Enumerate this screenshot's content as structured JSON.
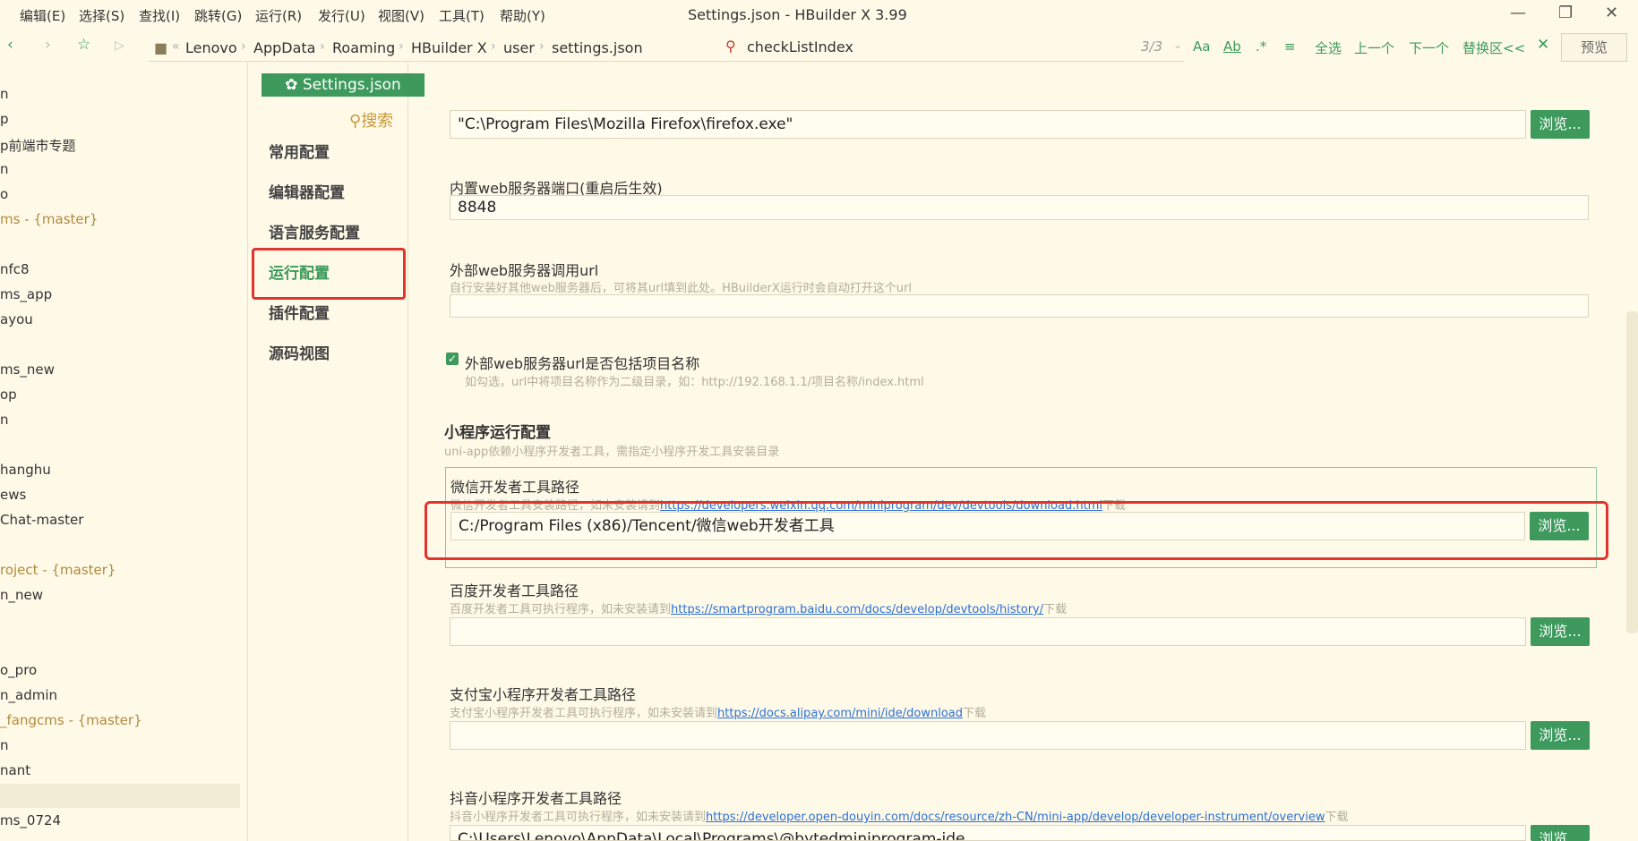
{
  "menu": [
    "编辑(E)",
    "选择(S)",
    "查找(I)",
    "跳转(G)",
    "运行(R)",
    "发行(U)",
    "视图(V)",
    "工具(T)",
    "帮助(Y)"
  ],
  "window_title": "Settings.json - HBuilder X 3.99",
  "breadcrumb": [
    "Lenovo",
    "AppData",
    "Roaming",
    "HBuilder X",
    "user",
    "settings.json"
  ],
  "find": {
    "text": "checkListIndex",
    "count": "3/3",
    "actions": [
      "全选",
      "上一个",
      "下一个",
      "替换区<<"
    ],
    "preview": "预览"
  },
  "tree": {
    "items": [
      {
        "label": "n",
        "git": false
      },
      {
        "label": "p",
        "git": false
      },
      {
        "label": "p前端市专题",
        "git": false
      },
      {
        "label": "n",
        "git": false
      },
      {
        "label": "o",
        "git": false
      },
      {
        "label": "ms - {master}",
        "git": true
      },
      {
        "label": "",
        "git": false
      },
      {
        "label": "nfc8",
        "git": false
      },
      {
        "label": "ms_app",
        "git": false
      },
      {
        "label": "ayou",
        "git": false
      },
      {
        "label": "",
        "git": false
      },
      {
        "label": "ms_new",
        "git": false
      },
      {
        "label": "op",
        "git": false
      },
      {
        "label": "n",
        "git": false
      },
      {
        "label": "",
        "git": false
      },
      {
        "label": "hanghu",
        "git": false
      },
      {
        "label": "ews",
        "git": false
      },
      {
        "label": "Chat-master",
        "git": false
      },
      {
        "label": "",
        "git": false
      },
      {
        "label": "roject - {master}",
        "git": true
      },
      {
        "label": "n_new",
        "git": false
      },
      {
        "label": "",
        "git": false
      },
      {
        "label": "",
        "git": false
      },
      {
        "label": "o_pro",
        "git": false
      },
      {
        "label": "n_admin",
        "git": false
      },
      {
        "label": "_fangcms - {master}",
        "git": true
      },
      {
        "label": "n",
        "git": false
      },
      {
        "label": "nant",
        "git": false
      },
      {
        "label": "",
        "git": false
      },
      {
        "label": "ms_0724",
        "git": false
      }
    ]
  },
  "settings_tab": "Settings.json",
  "search_label": "搜索",
  "nav": [
    "常用配置",
    "编辑器配置",
    "语言服务配置",
    "运行配置",
    "插件配置",
    "源码视图"
  ],
  "browse_label": "浏览...",
  "fields": {
    "firefox_path": "\"C:\\Program Files\\Mozilla Firefox\\firefox.exe\"",
    "port_label": "内置web服务器端口(重启后生效)",
    "port_value": "8848",
    "ext_url_label": "外部web服务器调用url",
    "ext_url_hint": "自行安装好其他web服务器后，可将其url填到此处。HBuilderX运行时会自动打开这个url",
    "include_label": "外部web服务器url是否包括项目名称",
    "include_hint": "如勾选，url中将项目名称作为二级目录，如：http://192.168.1.1/项目名称/index.html",
    "mini_title": "小程序运行配置",
    "mini_hint": "uni-app依赖小程序开发者工具，需指定小程序开发工具安装目录",
    "wx_label": "微信开发者工具路径",
    "wx_hint_pre": "微信开发者工具安装路径，如未安装请到",
    "wx_link": "https://developers.weixin.qq.com/miniprogram/dev/devtools/download.html",
    "wx_hint_post": "下载",
    "wx_value": "C:/Program Files (x86)/Tencent/微信web开发者工具",
    "baidu_label": "百度开发者工具路径",
    "baidu_hint_pre": "百度开发者工具可执行程序，如未安装请到",
    "baidu_link": "https://smartprogram.baidu.com/docs/develop/devtools/history/",
    "baidu_hint_post": "下载",
    "alipay_label": "支付宝小程序开发者工具路径",
    "alipay_hint_pre": "支付宝小程序开发者工具可执行程序，如未安装请到",
    "alipay_link": "https://docs.alipay.com/mini/ide/download",
    "alipay_hint_post": "下载",
    "douyin_label": "抖音小程序开发者工具路径",
    "douyin_hint_pre": "抖音小程序开发者工具可执行程序，如未安装请到",
    "douyin_link": "https://developer.open-douyin.com/docs/resource/zh-CN/mini-app/develop/developer-instrument/overview",
    "douyin_hint_post": "下载",
    "douyin_value": "C:\\Users\\Lenovo\\AppData\\Local\\Programs\\@bytedminiprogram-ide"
  }
}
